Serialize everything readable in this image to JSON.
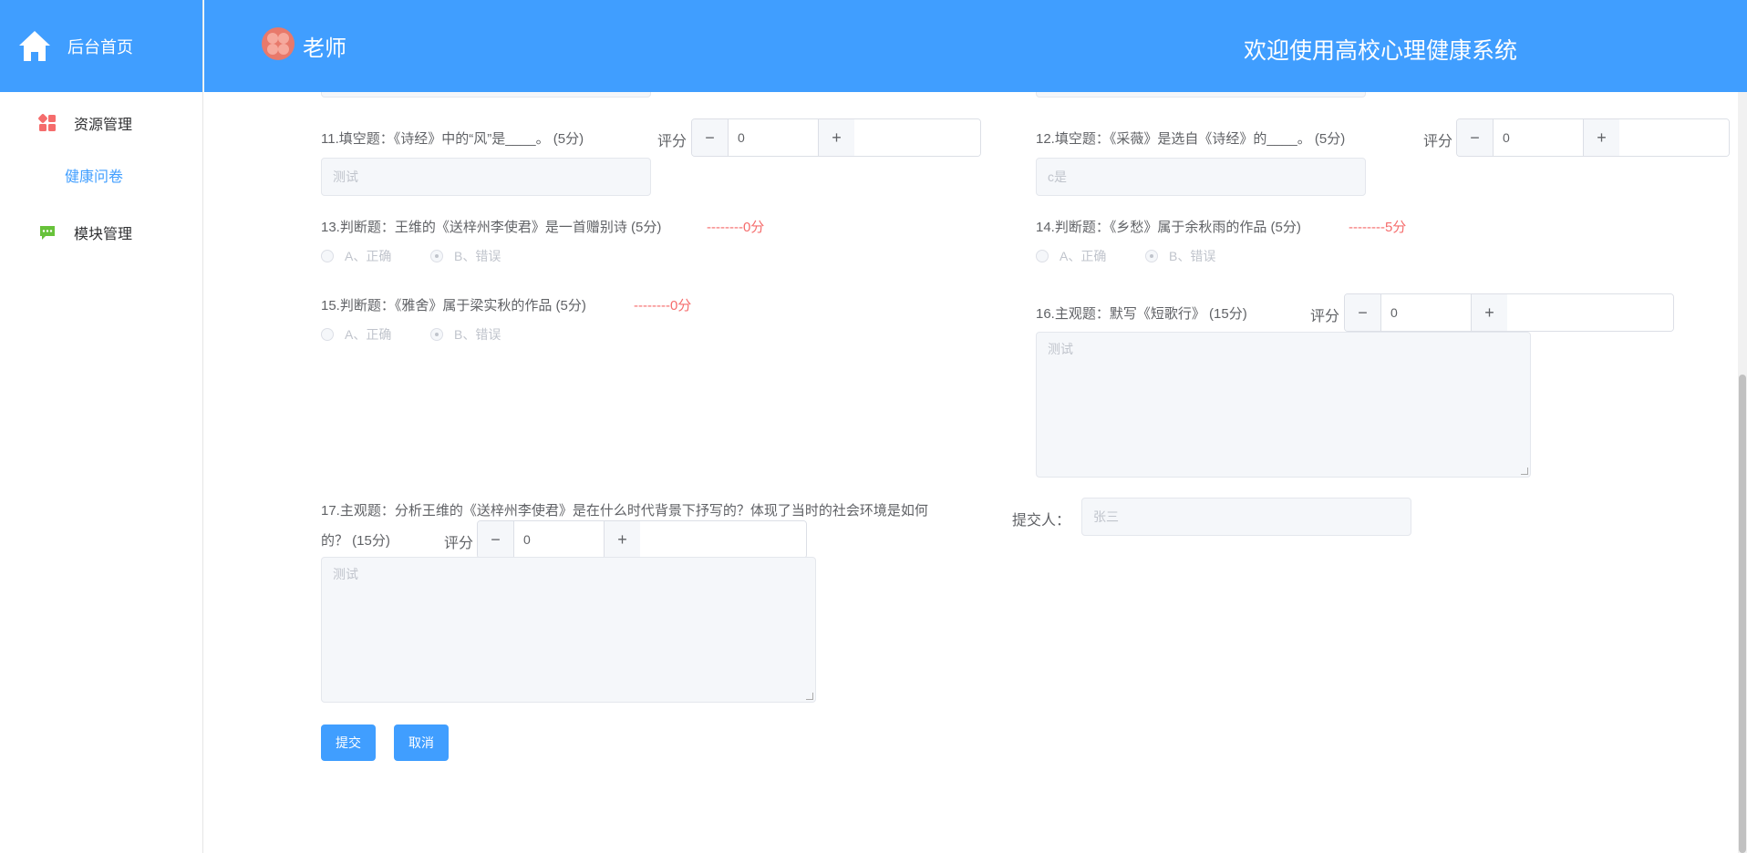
{
  "sidebar": {
    "home_label": "后台首页",
    "items": [
      {
        "label": "资源管理"
      },
      {
        "label": "健康问卷"
      },
      {
        "label": "模块管理"
      }
    ]
  },
  "header": {
    "role": "老师",
    "welcome": "欢迎使用高校心理健康系统"
  },
  "score_label": "评分",
  "questions": {
    "q11": {
      "text": "11.填空题：《诗经》中的“风”是____。 (5分)",
      "score": "0",
      "answer": "测试"
    },
    "q12": {
      "text": "12.填空题：《采薇》是选自《诗经》的____。 (5分)",
      "score": "0",
      "answer": "c是"
    },
    "q13": {
      "text": "13.判断题：王维的《送梓州李使君》是一首赠别诗 (5分)",
      "result": "--------0分",
      "opt_a": "A、正确",
      "opt_b": "B、错误"
    },
    "q14": {
      "text": "14.判断题：《乡愁》属于余秋雨的作品 (5分)",
      "result": "--------5分",
      "opt_a": "A、正确",
      "opt_b": "B、错误"
    },
    "q15": {
      "text": "15.判断题：《雅舍》属于梁实秋的作品 (5分)",
      "result": "--------0分",
      "opt_a": "A、正确",
      "opt_b": "B、错误"
    },
    "q16": {
      "text": "16.主观题：默写《短歌行》 (15分)",
      "score": "0",
      "answer": "测试"
    },
    "q17": {
      "text_line1": "17.主观题：分析王维的《送梓州李使君》是在什么时代背景下抒写的？体现了当时的社会环境是如何",
      "text_line2": "的？ (15分)",
      "score": "0",
      "answer": "测试"
    }
  },
  "submitter": {
    "label": "提交人：",
    "value": "张三"
  },
  "actions": {
    "submit": "提交",
    "cancel": "取消"
  },
  "colors": {
    "primary": "#409eff",
    "error": "#f56c6c"
  }
}
